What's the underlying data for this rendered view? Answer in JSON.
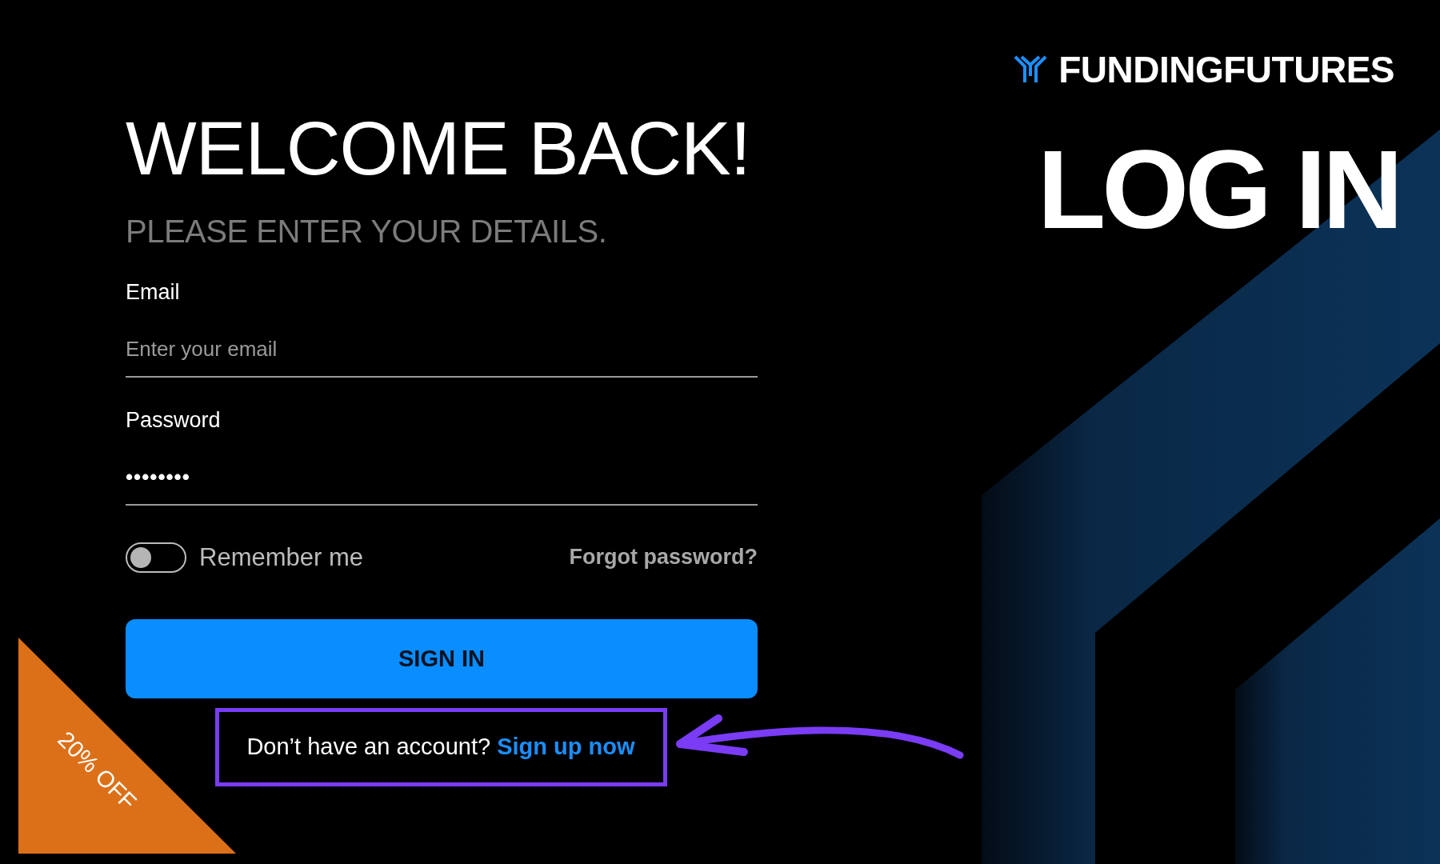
{
  "brand": {
    "name": "FUNDINGFUTURES"
  },
  "heading": "LOG IN",
  "form": {
    "title": "WELCOME BACK!",
    "subtitle": "PLEASE ENTER YOUR DETAILS.",
    "fields": [
      {
        "label": "Email",
        "placeholder": "Enter your email"
      },
      {
        "label": "Password",
        "value": "••••••••"
      }
    ],
    "remember": {
      "label": "Remember me",
      "on": false
    },
    "forgot": "Forgot password?",
    "submit": "SIGN IN",
    "signup": {
      "prompt": "Don’t have an account?",
      "link": "Sign up now"
    }
  },
  "promo": {
    "text": "20% OFF"
  }
}
